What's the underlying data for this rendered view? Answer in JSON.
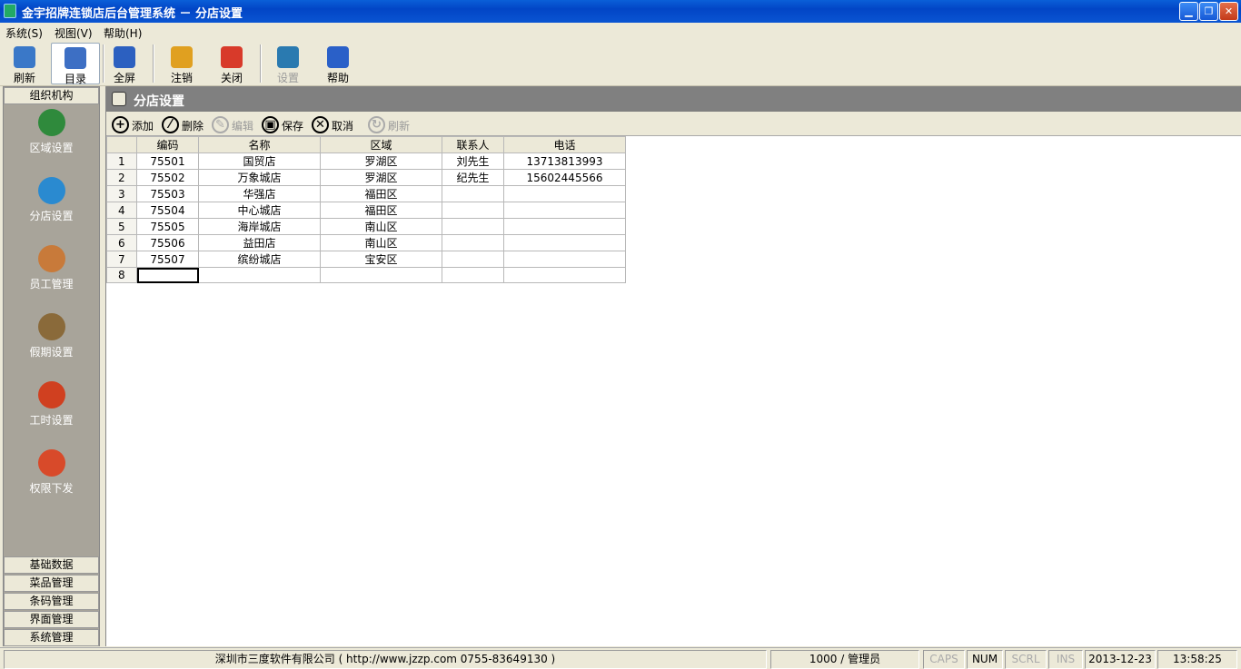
{
  "window": {
    "title": "金宇招牌连锁店后台管理系统 － 分店设置"
  },
  "menu": [
    {
      "label": "系统(S)"
    },
    {
      "label": "视图(V)"
    },
    {
      "label": "帮助(H)"
    }
  ],
  "toolbar": [
    {
      "label": "刷新",
      "icon": "refresh-icon",
      "color": "#3a78c8"
    },
    {
      "label": "目录",
      "icon": "catalog-icon",
      "color": "#3d6fc4"
    },
    {
      "label": "全屏",
      "icon": "fullscreen-icon",
      "color": "#2c60c0"
    },
    {
      "label": "注销",
      "icon": "logout-key-icon",
      "color": "#e0a020"
    },
    {
      "label": "关闭",
      "icon": "power-icon",
      "color": "#d83a2a"
    },
    {
      "label": "设置",
      "icon": "settings-globe-icon",
      "color": "#2a7ab0"
    },
    {
      "label": "帮助",
      "icon": "help-icon",
      "color": "#2a60c8"
    }
  ],
  "sidebar": {
    "header": "组织机构",
    "items": [
      {
        "label": "区域设置",
        "icon": "globe-icon",
        "color": "#2f8a3c"
      },
      {
        "label": "分店设置",
        "icon": "house-icon",
        "color": "#2a8ad0"
      },
      {
        "label": "员工管理",
        "icon": "users-icon",
        "color": "#c87a3a"
      },
      {
        "label": "假期设置",
        "icon": "calendar-icon",
        "color": "#8a6a3a"
      },
      {
        "label": "工时设置",
        "icon": "alarm-clock-icon",
        "color": "#d04020"
      },
      {
        "label": "权限下发",
        "icon": "permission-icon",
        "color": "#d84a2a"
      }
    ],
    "footer": [
      "基础数据",
      "菜品管理",
      "条码管理",
      "界面管理",
      "系统管理"
    ]
  },
  "panel": {
    "title": "分店设置"
  },
  "gridbar": [
    {
      "label": "添加",
      "icon": "add-icon",
      "glyph": "+"
    },
    {
      "label": "删除",
      "icon": "delete-icon",
      "glyph": "⁄"
    },
    {
      "label": "编辑",
      "icon": "edit-icon",
      "glyph": "✎"
    },
    {
      "label": "保存",
      "icon": "save-icon",
      "glyph": "▣"
    },
    {
      "label": "取消",
      "icon": "cancel-icon",
      "glyph": "✕"
    },
    {
      "label": "刷新",
      "icon": "refresh-small-icon",
      "glyph": "↻"
    }
  ],
  "table": {
    "columns": [
      "编码",
      "名称",
      "区域",
      "联系人",
      "电话"
    ],
    "rows": [
      {
        "n": "1",
        "code": "75501",
        "name": "国贸店",
        "area": "罗湖区",
        "contact": "刘先生",
        "phone": "13713813993"
      },
      {
        "n": "2",
        "code": "75502",
        "name": "万象城店",
        "area": "罗湖区",
        "contact": "纪先生",
        "phone": "15602445566"
      },
      {
        "n": "3",
        "code": "75503",
        "name": "华强店",
        "area": "福田区",
        "contact": "",
        "phone": ""
      },
      {
        "n": "4",
        "code": "75504",
        "name": "中心城店",
        "area": "福田区",
        "contact": "",
        "phone": ""
      },
      {
        "n": "5",
        "code": "75505",
        "name": "海岸城店",
        "area": "南山区",
        "contact": "",
        "phone": ""
      },
      {
        "n": "6",
        "code": "75506",
        "name": "益田店",
        "area": "南山区",
        "contact": "",
        "phone": ""
      },
      {
        "n": "7",
        "code": "75507",
        "name": "缤纷城店",
        "area": "宝安区",
        "contact": "",
        "phone": ""
      },
      {
        "n": "8",
        "code": "",
        "name": "",
        "area": "",
        "contact": "",
        "phone": ""
      }
    ]
  },
  "status": {
    "company": "深圳市三度软件有限公司 ( http://www.jzzp.com  0755-83649130 )",
    "user": "1000 / 管理员",
    "caps": "CAPS",
    "num": "NUM",
    "scrl": "SCRL",
    "ins": "INS",
    "date": "2013-12-23",
    "time": "13:58:25"
  }
}
